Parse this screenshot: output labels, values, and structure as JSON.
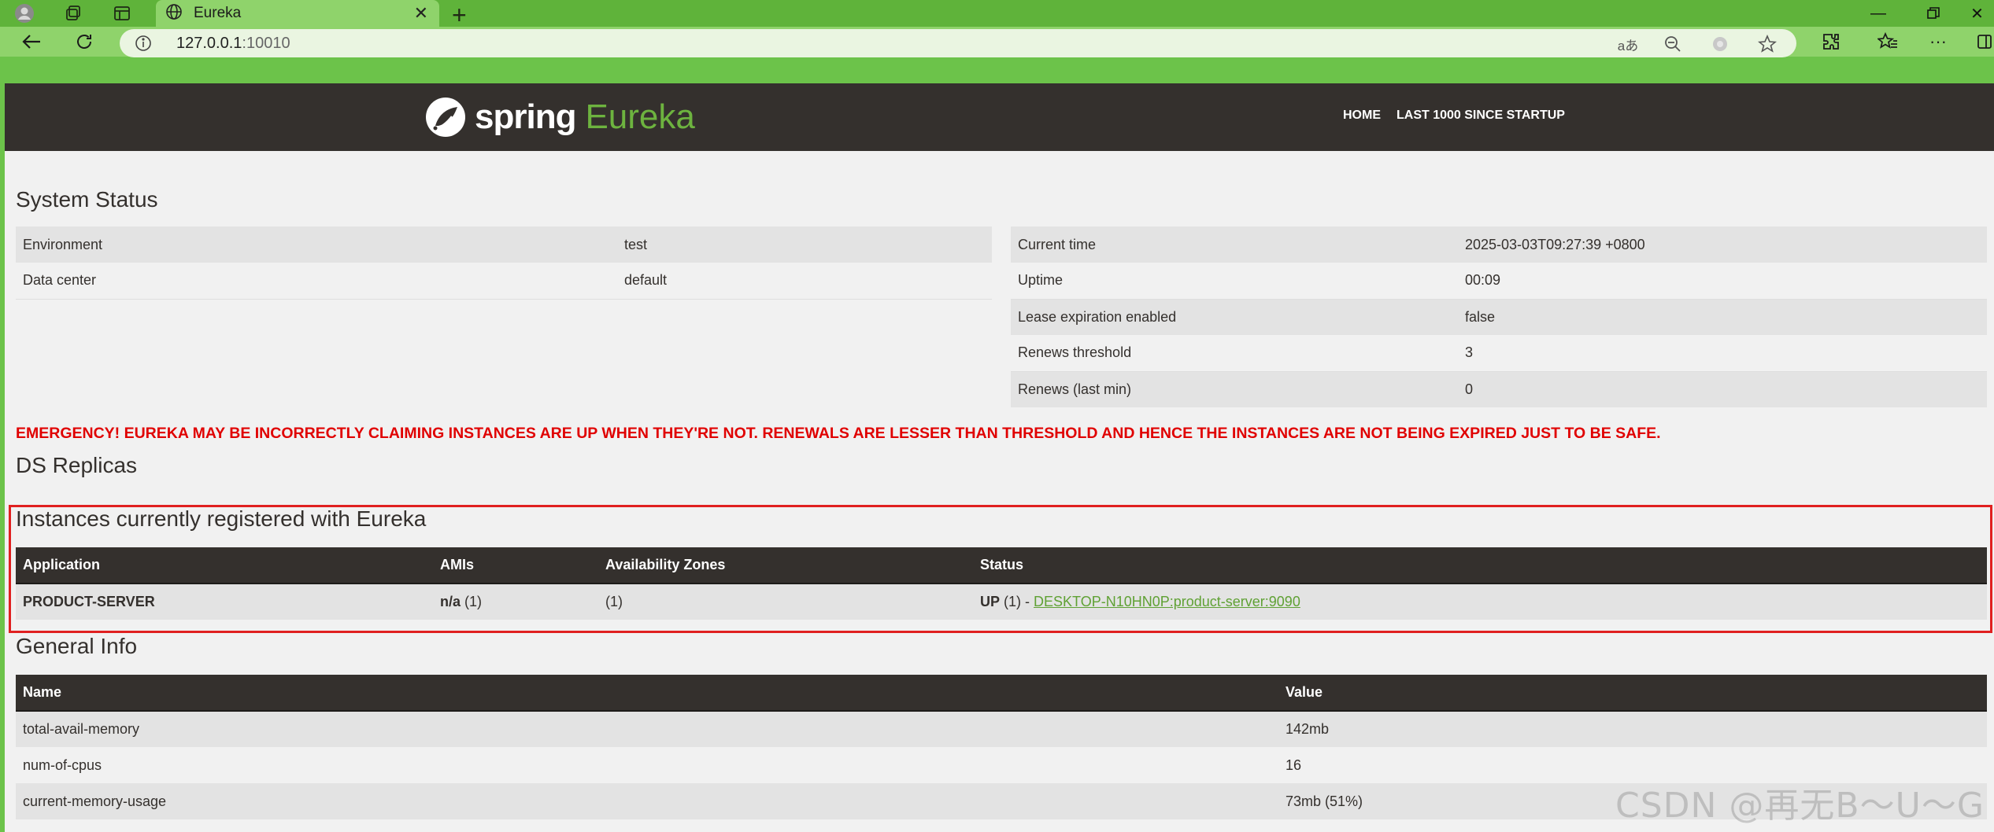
{
  "browser": {
    "tab_title": "Eureka",
    "url_host": "127.0.0.1",
    "url_port": ":10010",
    "read_aloud_label": "aあ"
  },
  "header": {
    "brand_spring": "spring",
    "brand_eureka": "Eureka",
    "nav": [
      "HOME",
      "LAST 1000 SINCE STARTUP"
    ]
  },
  "system_status": {
    "title": "System Status",
    "left": [
      {
        "label": "Environment",
        "value": "test"
      },
      {
        "label": "Data center",
        "value": "default"
      }
    ],
    "right": [
      {
        "label": "Current time",
        "value": "2025-03-03T09:27:39 +0800"
      },
      {
        "label": "Uptime",
        "value": "00:09"
      },
      {
        "label": "Lease expiration enabled",
        "value": "false"
      },
      {
        "label": "Renews threshold",
        "value": "3"
      },
      {
        "label": "Renews (last min)",
        "value": "0"
      }
    ]
  },
  "emergency": "EMERGENCY! EUREKA MAY BE INCORRECTLY CLAIMING INSTANCES ARE UP WHEN THEY'RE NOT. RENEWALS ARE LESSER THAN THRESHOLD AND HENCE THE INSTANCES ARE NOT BEING EXPIRED JUST TO BE SAFE.",
  "ds_replicas": {
    "title": "DS Replicas"
  },
  "instances": {
    "title": "Instances currently registered with Eureka",
    "columns": [
      "Application",
      "AMIs",
      "Availability Zones",
      "Status"
    ],
    "rows": [
      {
        "application": "PRODUCT-SERVER",
        "amis_bold": "n/a",
        "amis_count": " (1)",
        "zones": "(1)",
        "status_prefix": "UP",
        "status_count": " (1) - ",
        "status_link": "DESKTOP-N10HN0P:product-server:9090"
      }
    ]
  },
  "general_info": {
    "title": "General Info",
    "columns": [
      "Name",
      "Value"
    ],
    "rows": [
      {
        "name": "total-avail-memory",
        "value": "142mb"
      },
      {
        "name": "num-of-cpus",
        "value": "16"
      },
      {
        "name": "current-memory-usage",
        "value": "73mb (51%)"
      }
    ]
  },
  "watermark": "CSDN @再无B～U～G",
  "colors": {
    "browser_frame": "#6cc34a",
    "header_bg": "#34302d",
    "spring_green": "#6db33f",
    "emergency_red": "#e00000",
    "highlight_box": "#e02020"
  }
}
